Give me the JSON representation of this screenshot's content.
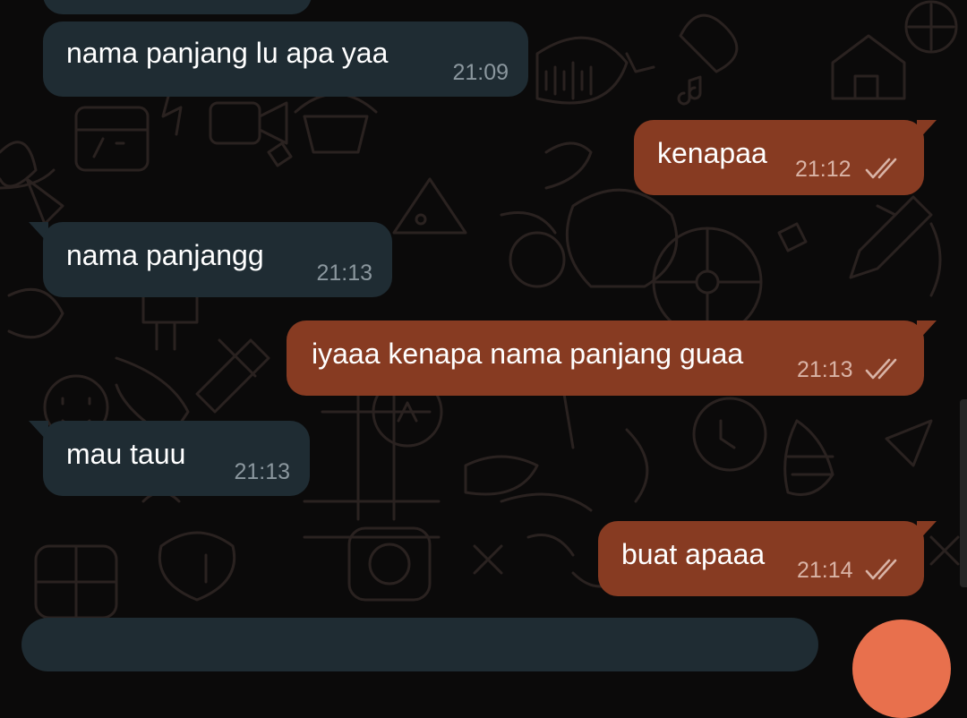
{
  "colors": {
    "background": "#0b0a0a",
    "incoming_bubble": "#1f2c33",
    "outgoing_bubble": "#873b22",
    "time_incoming": "#8b979e",
    "time_outgoing": "#d9b3a6",
    "fab": "#e8704d"
  },
  "messages": [
    {
      "direction": "in",
      "text": "nama panjang lu apa yaa",
      "time": "21:09"
    },
    {
      "direction": "out",
      "text": "kenapaa",
      "time": "21:12",
      "status": "read-double-check"
    },
    {
      "direction": "in",
      "text": "nama panjangg",
      "time": "21:13"
    },
    {
      "direction": "out",
      "text": "iyaaa kenapa nama panjang guaa",
      "time": "21:13",
      "status": "read-double-check"
    },
    {
      "direction": "in",
      "text": "mau tauu",
      "time": "21:13"
    },
    {
      "direction": "out",
      "text": "buat apaaa",
      "time": "21:14",
      "status": "read-double-check"
    }
  ],
  "icons": {
    "read_status": "double-check-icon",
    "fab": "voice-send-button"
  }
}
